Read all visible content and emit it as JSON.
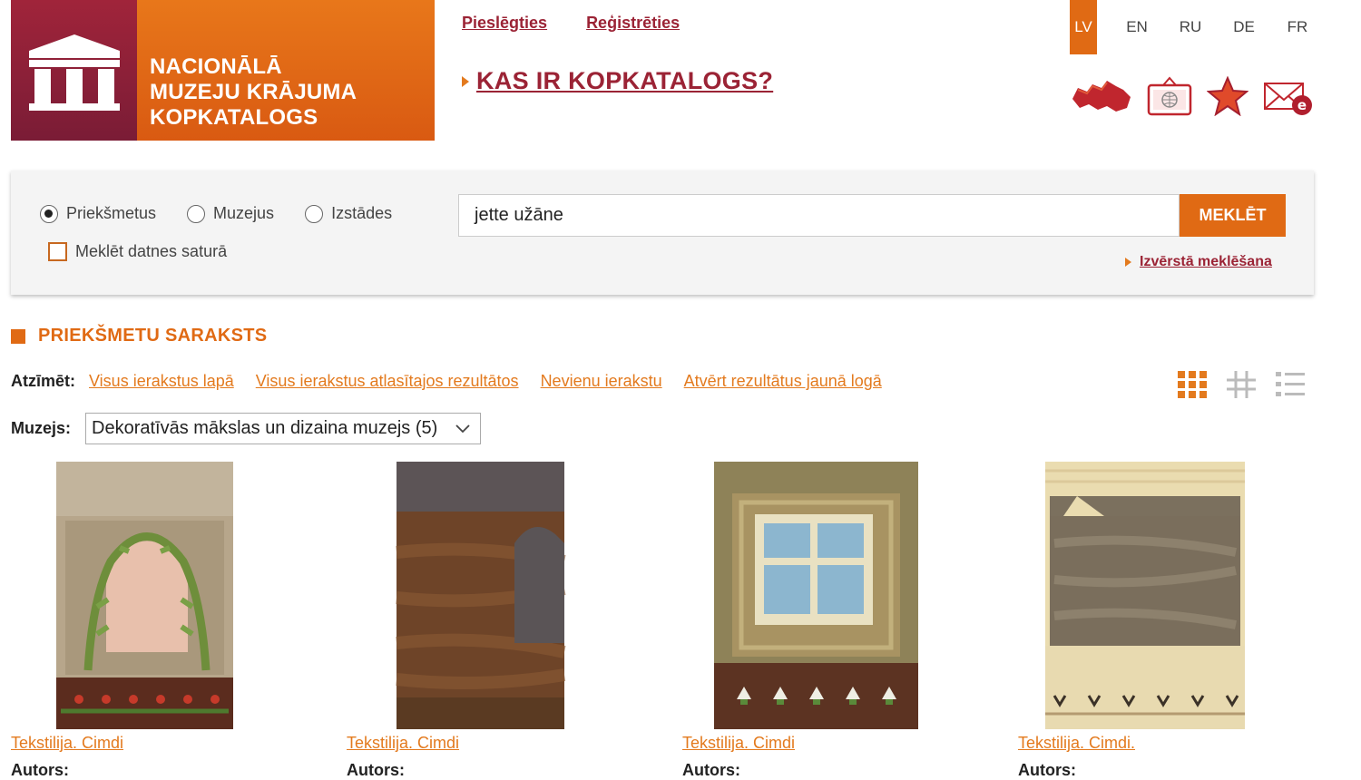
{
  "header": {
    "logo_lines": [
      "NACIONĀLĀ",
      "MUZEJU KRĀJUMA",
      "KOPKATALOGS"
    ],
    "login": "Pieslēgties",
    "register": "Reģistrēties",
    "about": "KAS IR KOPKATALOGS?",
    "languages": [
      {
        "code": "LV",
        "active": true
      },
      {
        "code": "EN",
        "active": false
      },
      {
        "code": "RU",
        "active": false
      },
      {
        "code": "DE",
        "active": false
      },
      {
        "code": "FR",
        "active": false
      }
    ],
    "tools": [
      "latvia-map-icon",
      "exhibition-globe-icon",
      "favorite-star-icon",
      "email-icon"
    ]
  },
  "search": {
    "options": [
      {
        "label": "Priekšmetus",
        "selected": true
      },
      {
        "label": "Muzejus",
        "selected": false
      },
      {
        "label": "Izstādes",
        "selected": false
      }
    ],
    "file_content_label": "Meklēt datnes saturā",
    "file_content_checked": false,
    "query": "jette užāne",
    "button": "MEKLĒT",
    "advanced": "Izvērstā meklēšana"
  },
  "results": {
    "title": "PRIEKŠMETU SARAKSTS",
    "mark_label": "Atzīmēt:",
    "mark_links": [
      "Visus ierakstus lapā",
      "Visus ierakstus atlasītajos rezultātos",
      "Nevienu ierakstu",
      "Atvērt rezultātus jaunā logā"
    ],
    "museum_label": "Muzejs:",
    "museum_selected": "Dekoratīvās mākslas un dizaina muzejs (5)",
    "view_modes": [
      "grid-view-icon",
      "table-view-icon",
      "list-view-icon"
    ],
    "items": [
      {
        "title": "Tekstilija. Cimdi",
        "author_label": "Autors:",
        "colors": {
          "bg": "#b2a08a",
          "main": "#a89677",
          "accent": "#6f8d3c",
          "detail": "#e8b9a4",
          "band": "#5a3020"
        }
      },
      {
        "title": "Tekstilija. Cimdi",
        "author_label": "Autors:",
        "colors": {
          "bg": "#6e6660",
          "main": "#6a4226",
          "accent": "#5b5658",
          "detail": "#7a4d2c",
          "band": "#553220"
        }
      },
      {
        "title": "Tekstilija. Cimdi",
        "author_label": "Autors:",
        "colors": {
          "bg": "#8a8060",
          "main": "#a08a58",
          "accent": "#8ab4cc",
          "detail": "#e8e0c0",
          "band": "#5c3322"
        }
      },
      {
        "title": "Tekstilija. Cimdi.",
        "author_label": "Autors:",
        "colors": {
          "bg": "#eadcb0",
          "main": "#7a6e5c",
          "accent": "#e8dab0",
          "detail": "#4a4030",
          "band": "#e8dab0"
        }
      }
    ]
  },
  "colors": {
    "accent": "#e06a14",
    "link_dark": "#9b2335",
    "logo_dark": "#7a1c36"
  }
}
